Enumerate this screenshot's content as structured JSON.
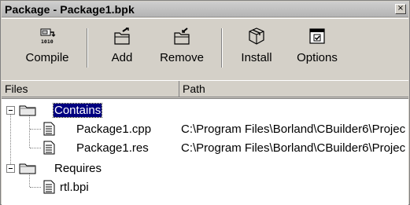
{
  "window": {
    "title": "Package - Package1.bpk",
    "close_glyph": "×"
  },
  "toolbar": {
    "buttons": [
      {
        "label": "Compile",
        "icon": "compile-icon"
      },
      {
        "label": "Add",
        "icon": "add-file-icon"
      },
      {
        "label": "Remove",
        "icon": "remove-file-icon"
      },
      {
        "label": "Install",
        "icon": "install-package-icon"
      },
      {
        "label": "Options",
        "icon": "options-icon"
      }
    ]
  },
  "columns": {
    "files": "Files",
    "path": "Path"
  },
  "tree": {
    "contains": {
      "label": "Contains",
      "items": [
        {
          "name": "Package1.cpp",
          "path": "C:\\Program Files\\Borland\\CBuilder6\\Projec"
        },
        {
          "name": "Package1.res",
          "path": "C:\\Program Files\\Borland\\CBuilder6\\Projec"
        }
      ]
    },
    "requires": {
      "label": "Requires",
      "items": [
        {
          "name": "rtl.bpi",
          "path": ""
        }
      ]
    }
  },
  "colors": {
    "selection": "#000080",
    "face": "#d4d0c8"
  }
}
